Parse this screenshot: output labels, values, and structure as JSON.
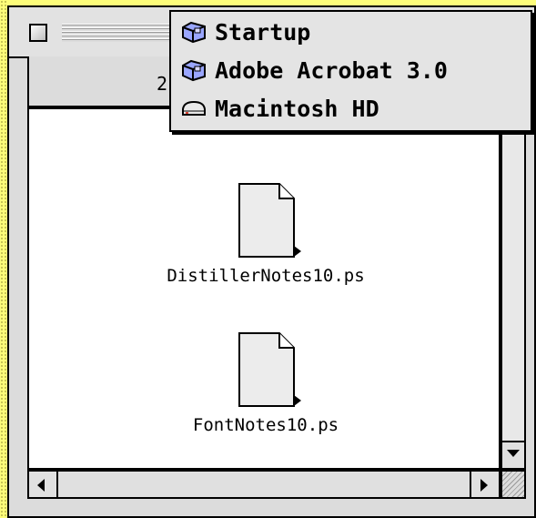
{
  "window": {
    "header_text": "2"
  },
  "files": [
    {
      "name": "DistillerNotes10.ps",
      "icon": "document-icon"
    },
    {
      "name": "FontNotes10.ps",
      "icon": "document-icon"
    }
  ],
  "path_menu": {
    "items": [
      {
        "label": "Startup",
        "icon": "folder-icon"
      },
      {
        "label": "Adobe Acrobat 3.0",
        "icon": "folder-icon"
      },
      {
        "label": "Macintosh HD",
        "icon": "hard-disk-icon"
      }
    ]
  },
  "colors": {
    "desktop": "#fdfd7a",
    "window_chrome": "#dcdcdc",
    "content_bg": "#ffffff"
  }
}
